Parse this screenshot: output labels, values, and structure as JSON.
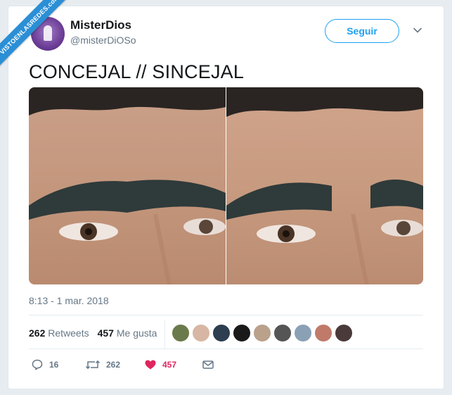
{
  "watermark": "VISTOENLASREDES.com",
  "user": {
    "name": "MisterDios",
    "handle": "@misterDiOSo"
  },
  "follow_label": "Seguir",
  "tweet_text": "CONCEJAL // SINCEJAL",
  "timestamp": "8:13 - 1 mar. 2018",
  "stats": {
    "retweets_count": "262",
    "retweets_label": "Retweets",
    "likes_count": "457",
    "likes_label": "Me gusta"
  },
  "likers": [
    "#6b7a4a",
    "#d8b6a4",
    "#2c3e50",
    "#1a1a1a",
    "#b9a18a",
    "#555555",
    "#8aa0b5",
    "#c07a6a",
    "#4a3a3a"
  ],
  "actions": {
    "replies": "16",
    "retweets": "262",
    "likes": "457"
  },
  "colors": {
    "accent": "#1da1f2",
    "like": "#e0245e",
    "muted": "#657786",
    "text": "#14171a"
  }
}
